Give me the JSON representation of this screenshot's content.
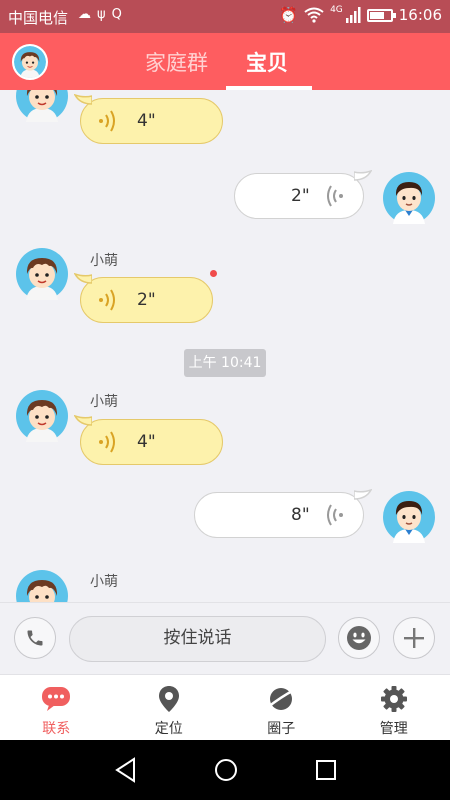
{
  "status_bar": {
    "carrier": "中国电信",
    "time": "16:06",
    "network": "4G"
  },
  "header": {
    "tabs": [
      {
        "label": "家庭群",
        "active": false
      },
      {
        "label": "宝贝",
        "active": true
      }
    ]
  },
  "chat": {
    "messages": [
      {
        "direction": "in",
        "sender": "",
        "duration": "4\""
      },
      {
        "direction": "out",
        "sender": "",
        "duration": "2\""
      },
      {
        "direction": "in",
        "sender": "小萌",
        "duration": "2\"",
        "unread": true
      },
      {
        "direction": "in",
        "sender": "小萌",
        "duration": "4\""
      },
      {
        "direction": "out",
        "sender": "",
        "duration": "8\""
      },
      {
        "direction": "in",
        "sender": "小萌",
        "duration": ""
      }
    ],
    "time_separator": "上午 10:41"
  },
  "input_bar": {
    "hold_to_talk": "按住说话"
  },
  "bottom_nav": {
    "items": [
      {
        "label": "联系",
        "icon": "chat-bubble-icon",
        "active": true
      },
      {
        "label": "定位",
        "icon": "location-pin-icon",
        "active": false
      },
      {
        "label": "圈子",
        "icon": "planet-icon",
        "active": false
      },
      {
        "label": "管理",
        "icon": "gear-icon",
        "active": false
      }
    ]
  },
  "colors": {
    "header": "#fe5d60",
    "accent": "#f05f5f",
    "incoming_bubble": "#fdf2ac",
    "outgoing_bubble": "#ffffff"
  }
}
